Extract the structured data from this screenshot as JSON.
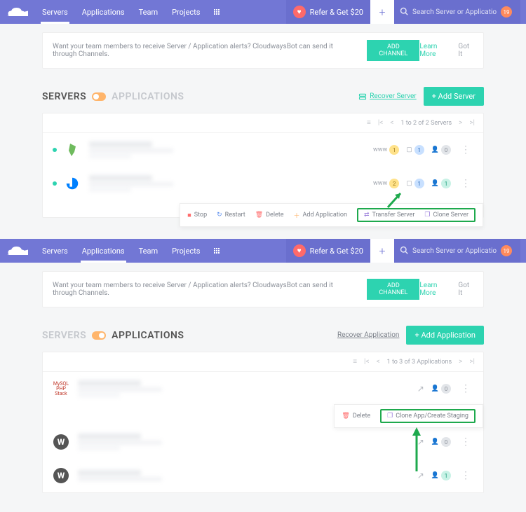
{
  "topbar": {
    "nav": {
      "servers": "Servers",
      "applications": "Applications",
      "team": "Team",
      "projects": "Projects"
    },
    "refer": "Refer & Get $20",
    "search_placeholder": "Search Server or Application",
    "notif_count": "19"
  },
  "alert": {
    "text": "Want your team members to receive Server / Application alerts? CloudwaysBot can send it through Channels.",
    "add_channel": "ADD CHANNEL",
    "learn_more": "Learn More",
    "got_it": "Got It"
  },
  "servers_section": {
    "title_servers": "SERVERS",
    "title_apps": "APPLICATIONS",
    "recover": "Recover Server",
    "add": "Add Server",
    "paginator": "1 to 2 of 2 Servers",
    "rows": [
      {
        "www": "www",
        "www_count": "1",
        "apps": "1",
        "users": "0"
      },
      {
        "www": "www",
        "www_count": "2",
        "apps": "1",
        "users": "1"
      }
    ],
    "actions": {
      "stop": "Stop",
      "restart": "Restart",
      "delete": "Delete",
      "add_app": "Add Application",
      "transfer": "Transfer Server",
      "clone": "Clone Server"
    }
  },
  "apps_section": {
    "title_servers": "SERVERS",
    "title_apps": "APPLICATIONS",
    "recover": "Recover Application",
    "add": "Add Application",
    "paginator": "1 to 3 of 3 Applications",
    "php_label_top": "MySQL",
    "php_label_bot": "PHP Stack",
    "rows": [
      {
        "users": "0"
      },
      {
        "users": "0"
      },
      {
        "users": "1"
      }
    ],
    "actions": {
      "delete": "Delete",
      "clone_staging": "Clone App/Create Staging"
    }
  }
}
